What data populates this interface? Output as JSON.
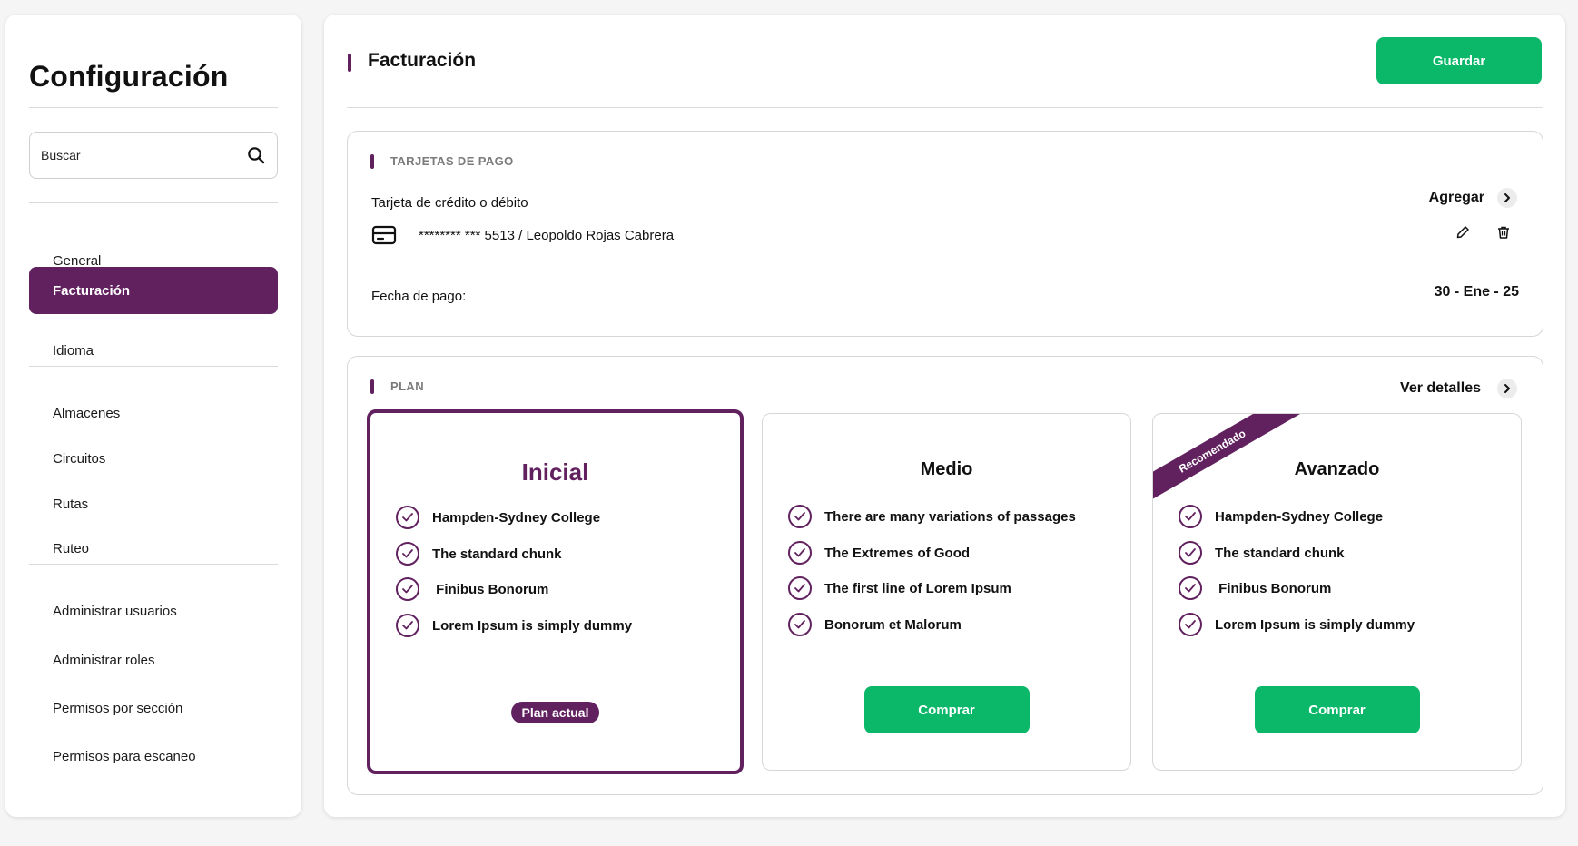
{
  "colors": {
    "accent": "#61215f",
    "success": "#0bb86a"
  },
  "sidebar": {
    "title": "Configuración",
    "search": {
      "placeholder": "Buscar",
      "icon": "search-icon"
    },
    "items": [
      {
        "label": "General",
        "active": false
      },
      {
        "label": "Facturación",
        "active": true
      },
      {
        "label": "Idioma",
        "active": false
      },
      {
        "label": "Almacenes",
        "active": false
      },
      {
        "label": "Circuitos",
        "active": false
      },
      {
        "label": "Rutas",
        "active": false
      },
      {
        "label": "Ruteo",
        "active": false
      },
      {
        "label": "Administrar usuarios",
        "active": false
      },
      {
        "label": "Administrar roles",
        "active": false
      },
      {
        "label": "Permisos por sección",
        "active": false
      },
      {
        "label": "Permisos para escaneo",
        "active": false
      }
    ]
  },
  "header": {
    "title": "Facturación",
    "save_label": "Guardar"
  },
  "payment": {
    "section_label": "TARJETAS DE PAGO",
    "method_label": "Tarjeta de crédito o débito",
    "add_label": "Agregar",
    "card_number": "******** *** 5513",
    "separator": " / ",
    "card_holder": "Leopoldo Rojas Cabrera",
    "date_label": "Fecha de pago:",
    "date_value": "30 - Ene - 25"
  },
  "plan": {
    "section_label": "PLAN",
    "details_label": "Ver detalles",
    "plans": [
      {
        "name": "Inicial",
        "current": true,
        "badge": "Plan actual",
        "features": [
          "Hampden-Sydney College",
          "The standard chunk",
          " Finibus Bonorum",
          "Lorem Ipsum is simply dummy"
        ]
      },
      {
        "name": "Medio",
        "current": false,
        "button": "Comprar",
        "features": [
          "There are many variations of passages",
          "The Extremes of Good",
          "The first line of Lorem Ipsum",
          "Bonorum et Malorum"
        ]
      },
      {
        "name": "Avanzado",
        "current": false,
        "ribbon": "Recomendado",
        "button": "Comprar",
        "features": [
          "Hampden-Sydney College",
          "The standard chunk",
          " Finibus Bonorum",
          "Lorem Ipsum is simply dummy"
        ]
      }
    ]
  }
}
